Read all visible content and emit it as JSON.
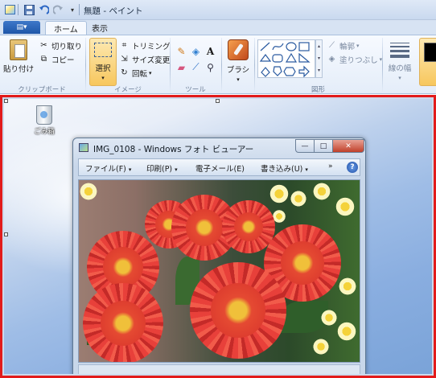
{
  "window": {
    "title": "無題 - ペイント"
  },
  "quick_access": {
    "save_icon": "save-icon",
    "undo_icon": "undo-icon",
    "redo_icon": "redo-icon",
    "menu_glyph": "▾"
  },
  "tabs": {
    "paint_menu_glyph": "▤▾",
    "home": "ホーム",
    "view": "表示"
  },
  "ribbon": {
    "clipboard": {
      "label": "クリップボード",
      "paste": "貼り付け",
      "cut": "切り取り",
      "copy": "コピー"
    },
    "image": {
      "label": "イメージ",
      "select": "選択",
      "crop": "トリミング",
      "resize": "サイズ変更",
      "rotate": "回転"
    },
    "tools": {
      "label": "ツール",
      "text_glyph": "A"
    },
    "brush": {
      "label": "ブラシ"
    },
    "shapes": {
      "label": "図形",
      "outline": "輪郭",
      "fill": "塗りつぶし"
    },
    "stroke": {
      "label": "線の幅"
    },
    "accent": "#f7c75e"
  },
  "desktop": {
    "recycle_bin_label": "ごみ箱"
  },
  "photo_viewer": {
    "title": "IMG_0108 - Windows フォト ビューアー",
    "menu": {
      "file": "ファイル(F)",
      "print": "印刷(P)",
      "email": "電子メール(E)",
      "burn": "書き込み(U)",
      "more": "»",
      "help": "?"
    },
    "buttons": {
      "minimize": "—",
      "maximize": "□",
      "close": "✕"
    }
  },
  "colors": {
    "selection_frame": "#e21b1b",
    "flower_red": "#e8403a"
  }
}
